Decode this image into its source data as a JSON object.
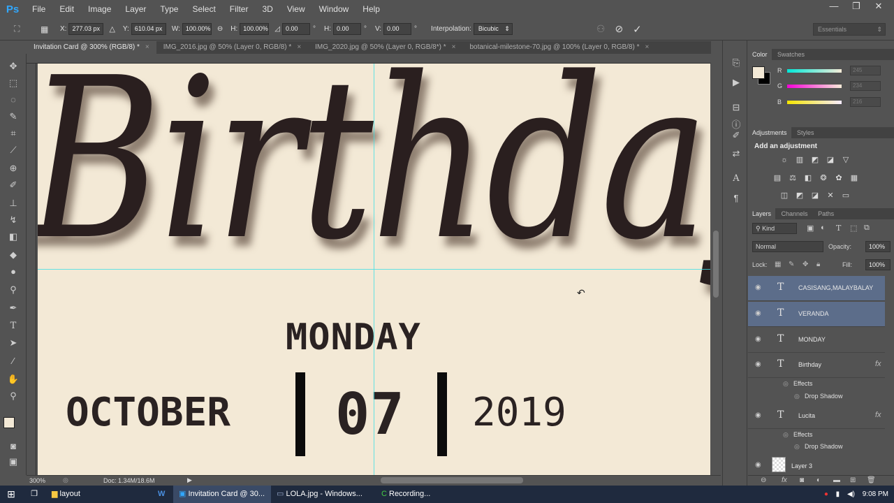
{
  "app": {
    "logo": "Ps"
  },
  "menu": [
    "File",
    "Edit",
    "Image",
    "Layer",
    "Type",
    "Select",
    "Filter",
    "3D",
    "View",
    "Window",
    "Help"
  ],
  "window_controls": [
    "—",
    "❐",
    "✕"
  ],
  "options": {
    "x_label": "X:",
    "x_value": "277.03 px",
    "y_label": "Y:",
    "y_value": "610.04 px",
    "w_label": "W:",
    "w_value": "100.00%",
    "h_label": "H:",
    "h_value": "100.00%",
    "angle_value": "0.00",
    "angle_unit": "°",
    "hskew_label": "H:",
    "hskew_value": "0.00",
    "hskew_unit": "°",
    "vskew_label": "V:",
    "vskew_value": "0.00",
    "vskew_unit": "°",
    "interp_label": "Interpolation:",
    "interp_value": "Bicubic",
    "workspace": "Essentials"
  },
  "tabs": [
    {
      "label": "Invitation Card @ 300% (RGB/8) *"
    },
    {
      "label": "IMG_2016.jpg @ 50% (Layer 0, RGB/8) *"
    },
    {
      "label": "IMG_2020.jpg @ 50% (Layer 0, RGB/8*) *"
    },
    {
      "label": "botanical-milestone-70.jpg @ 100% (Layer 0, RGB/8) *"
    }
  ],
  "canvas": {
    "title": "Birthday",
    "weekday": "MONDAY",
    "month": "OCTOBER",
    "day": "07",
    "year": "2019"
  },
  "status": {
    "zoom": "300%",
    "doc": "Doc: 1.34M/18.6M"
  },
  "color_panel": {
    "tabs": [
      "Color",
      "Swatches"
    ],
    "r_label": "R",
    "r_value": "245",
    "g_label": "G",
    "g_value": "234",
    "b_label": "B",
    "b_value": "216",
    "fg_color": "#f3e9d6",
    "bg_color": "#000000"
  },
  "adjustments_panel": {
    "tabs": [
      "Adjustments",
      "Styles"
    ],
    "title": "Add an adjustment"
  },
  "layers_panel": {
    "tabs": [
      "Layers",
      "Channels",
      "Paths"
    ],
    "kind": "Kind",
    "blend_mode": "Normal",
    "opacity_label": "Opacity:",
    "opacity_value": "100%",
    "lock_label": "Lock:",
    "fill_label": "Fill:",
    "fill_value": "100%",
    "layers": [
      {
        "name": "CASISANG,MALAYBALAY",
        "selected": true
      },
      {
        "name": "VERANDA",
        "selected": true
      },
      {
        "name": "MONDAY",
        "selected": false
      },
      {
        "name": "Birthday",
        "selected": false,
        "fx": true
      },
      {
        "name": "Lucita",
        "selected": false,
        "fx": true
      },
      {
        "name": "Layer 3",
        "selected": false
      }
    ],
    "effects_label": "Effects",
    "drop_shadow_label": "Drop Shadow"
  },
  "taskbar": {
    "items": [
      "layout",
      "Invitation Card @ 30...",
      "LOLA.jpg - Windows...",
      "Recording..."
    ],
    "time": "9:08 PM"
  }
}
